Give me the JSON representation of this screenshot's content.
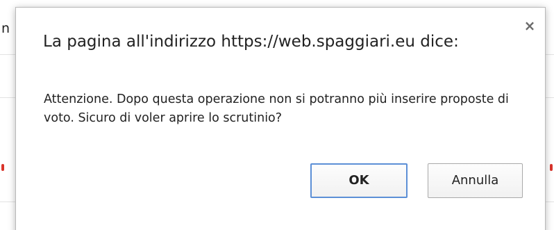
{
  "background": {
    "partial_text": "n"
  },
  "dialog": {
    "title": "La pagina all'indirizzo https://web.spaggiari.eu dice:",
    "close_glyph": "×",
    "message": "Attenzione. Dopo questa operazione non si potranno più inserire proposte di voto. Sicuro di voler aprire lo scrutinio?",
    "buttons": {
      "ok_label": "OK",
      "cancel_label": "Annulla"
    }
  },
  "colors": {
    "ok_button_border": "#5c8fd6",
    "background_marker": "#d9342b"
  }
}
